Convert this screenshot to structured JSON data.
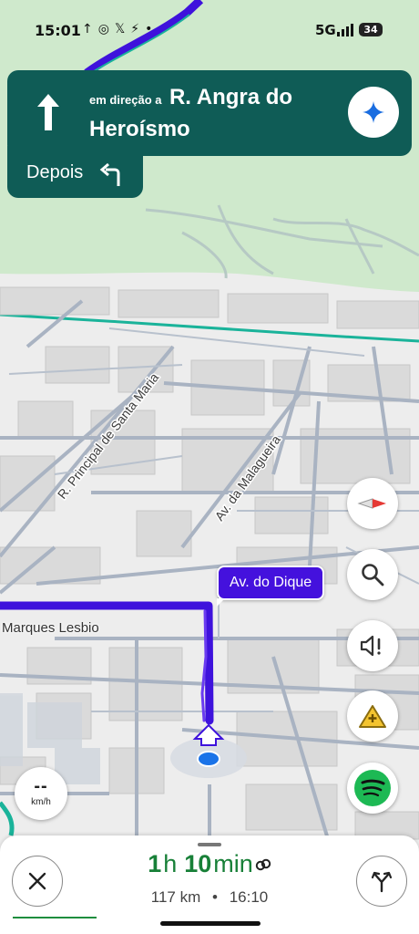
{
  "status_bar": {
    "time": "15:01",
    "notification_icons": [
      "location-arrow-icon",
      "whatsapp-icon",
      "x-icon",
      "messenger-icon",
      "dot-icon"
    ],
    "network": "5G",
    "battery": "34"
  },
  "navigation": {
    "direction_prefix": "em direção a",
    "street": "R. Angra do Heroísmo",
    "then_label": "Depois",
    "turn_icon": "straight-arrow-icon",
    "then_icon": "turn-left-icon"
  },
  "map": {
    "street_labels": [
      "R. Principal de Santa Maria",
      "Av. da Malagueira",
      "Marques Lesbio"
    ],
    "road_callout": "Av. do Dique",
    "route_color": "#3e12dc",
    "park_color": "#cfe9cc",
    "coast_color": "#1ab39a"
  },
  "controls": {
    "compass": "compass-icon",
    "search": "search-icon",
    "sound": "volume-alert-icon",
    "report": "report-incident-icon",
    "music": "spotify-icon"
  },
  "speedometer": {
    "value": "--",
    "unit": "km/h"
  },
  "trip": {
    "hours": "1",
    "hours_unit": "h",
    "minutes": "10",
    "minutes_unit": "min",
    "distance": "117 km",
    "separator": "•",
    "arrival": "16:10"
  },
  "colors": {
    "nav_card": "#0f5c56",
    "eta_green": "#188038"
  }
}
